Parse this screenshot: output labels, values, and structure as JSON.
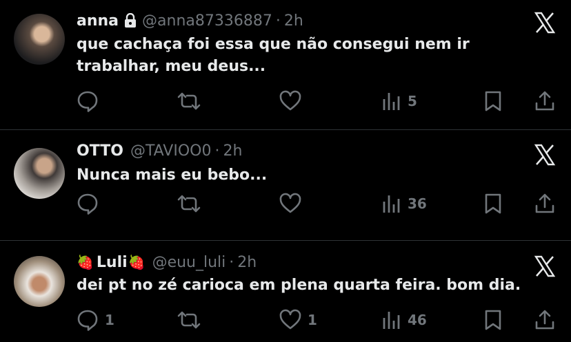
{
  "tweets": [
    {
      "name": "anna",
      "locked": true,
      "handle": "@anna87336887",
      "dot": "·",
      "time": "2h",
      "text": "que cachaça foi essa que não consegui nem ir trabalhar, meu deus...",
      "replies": "",
      "retweets": "",
      "likes": "",
      "views": "5"
    },
    {
      "name": "OTTO",
      "handle": "@TAVIOO0",
      "dot": "·",
      "time": "2h",
      "text": "Nunca mais eu bebo...",
      "replies": "",
      "retweets": "",
      "likes": "",
      "views": "36"
    },
    {
      "name_prefix": "🍓",
      "name": "Luli",
      "name_suffix": "🍓",
      "handle": "@euu_luli",
      "dot": "·",
      "time": "2h",
      "text": "dei pt no zé carioca em plena quarta feira. bom dia.",
      "replies": "1",
      "retweets": "",
      "likes": "1",
      "views": "46"
    }
  ],
  "icons": {
    "close": "x-logo-icon",
    "reply": "reply-icon",
    "retweet": "retweet-icon",
    "like": "heart-icon",
    "views": "views-icon",
    "bookmark": "bookmark-icon",
    "share": "share-icon",
    "lock": "lock-icon"
  },
  "colors": {
    "background": "#000000",
    "text": "#e7e9ea",
    "muted": "#71767b",
    "divider": "#2f3336"
  }
}
